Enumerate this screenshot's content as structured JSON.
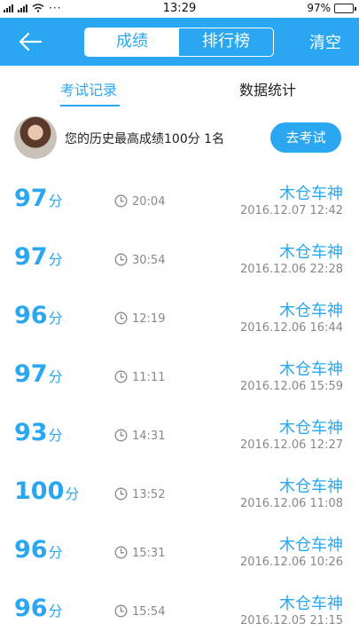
{
  "status": {
    "time": "13:29",
    "battery": "97%",
    "battery_level": 0.97
  },
  "header": {
    "tab_scores": "成绩",
    "tab_ranking": "排行榜",
    "clear": "清空"
  },
  "subtabs": {
    "records": "考试记录",
    "stats": "数据统计"
  },
  "profile": {
    "best": "您的历史最高成绩100分  1名",
    "exam_button": "去考试"
  },
  "records": [
    {
      "score": "97",
      "unit": "分",
      "duration": "20:04",
      "name": "木仓车神",
      "date": "2016.12.07  12:42"
    },
    {
      "score": "97",
      "unit": "分",
      "duration": "30:54",
      "name": "木仓车神",
      "date": "2016.12.06  22:28"
    },
    {
      "score": "96",
      "unit": "分",
      "duration": "12:19",
      "name": "木仓车神",
      "date": "2016.12.06  16:44"
    },
    {
      "score": "97",
      "unit": "分",
      "duration": "11:11",
      "name": "木仓车神",
      "date": "2016.12.06  15:59"
    },
    {
      "score": "93",
      "unit": "分",
      "duration": "14:31",
      "name": "木仓车神",
      "date": "2016.12.06  12:27"
    },
    {
      "score": "100",
      "unit": "分",
      "duration": "13:52",
      "name": "木仓车神",
      "date": "2016.12.06  11:08"
    },
    {
      "score": "96",
      "unit": "分",
      "duration": "15:31",
      "name": "木仓车神",
      "date": "2016.12.06  10:26"
    },
    {
      "score": "96",
      "unit": "分",
      "duration": "15:54",
      "name": "木仓车神",
      "date": "2016.12.05  21:15"
    }
  ],
  "colors": {
    "accent": "#2aa7f0",
    "muted": "#888888"
  },
  "icons": {
    "back": "arrow-left-icon",
    "duration": "clock-icon"
  }
}
